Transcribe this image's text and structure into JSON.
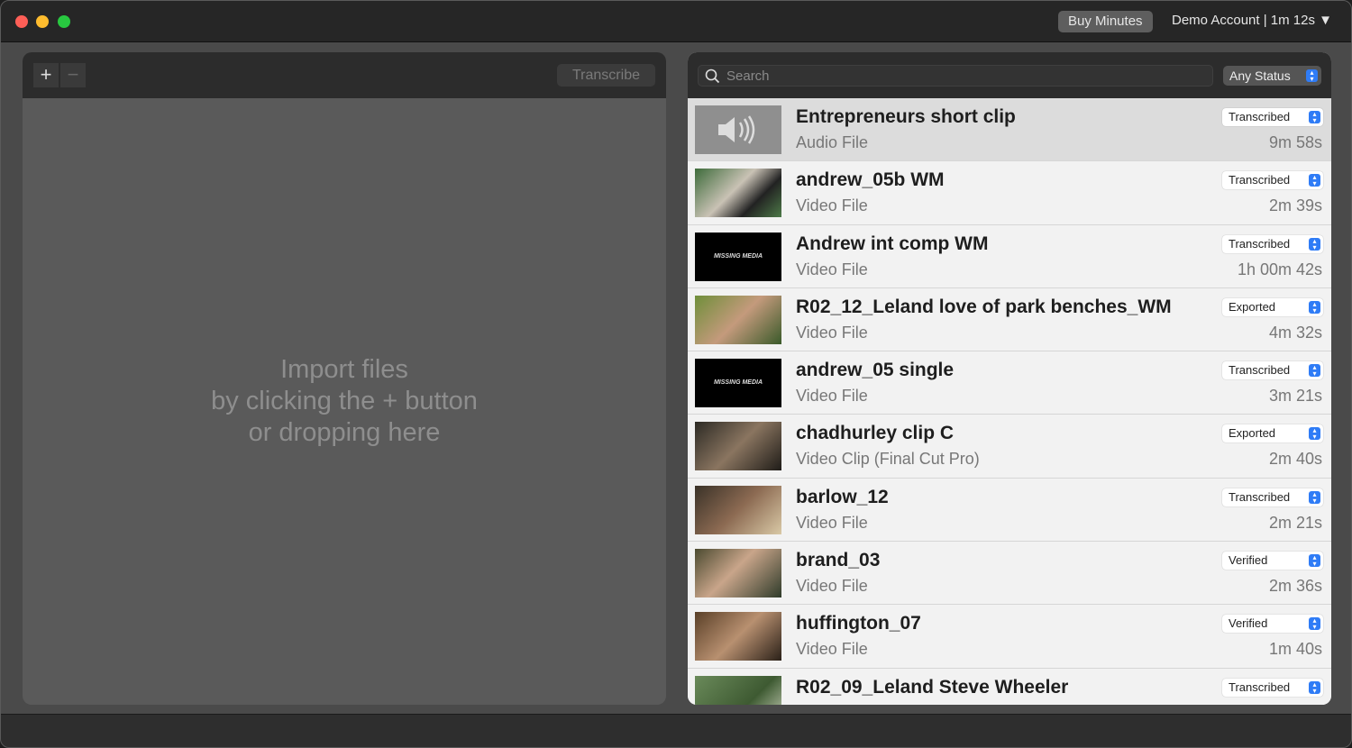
{
  "header": {
    "buy_minutes": "Buy Minutes",
    "account": "Demo Account | 1m 12s ▼"
  },
  "left": {
    "add": "+",
    "remove": "−",
    "transcribe": "Transcribe",
    "drop_lines": [
      "Import files",
      "by clicking the + button",
      "or dropping here"
    ]
  },
  "right": {
    "search_placeholder": "Search",
    "status_filter": "Any Status",
    "items": [
      {
        "name": "Entrepreneurs short clip",
        "type": "Audio File",
        "status": "Transcribed",
        "duration": "9m 58s",
        "thumb": "audio"
      },
      {
        "name": "andrew_05b WM",
        "type": "Video File",
        "status": "Transcribed",
        "duration": "2m 39s",
        "thumb": "video"
      },
      {
        "name": "Andrew int comp WM",
        "type": "Video File",
        "status": "Transcribed",
        "duration": "1h 00m 42s",
        "thumb": "missing"
      },
      {
        "name": "R02_12_Leland love of park benches_WM",
        "type": "Video File",
        "status": "Exported",
        "duration": "4m 32s",
        "thumb": "video"
      },
      {
        "name": "andrew_05 single",
        "type": "Video File",
        "status": "Transcribed",
        "duration": "3m 21s",
        "thumb": "missing"
      },
      {
        "name": "chadhurley clip C",
        "type": "Video Clip (Final Cut Pro)",
        "status": "Exported",
        "duration": "2m 40s",
        "thumb": "video"
      },
      {
        "name": "barlow_12",
        "type": "Video File",
        "status": "Transcribed",
        "duration": "2m 21s",
        "thumb": "video"
      },
      {
        "name": "brand_03",
        "type": "Video File",
        "status": "Verified",
        "duration": "2m 36s",
        "thumb": "video"
      },
      {
        "name": "huffington_07",
        "type": "Video File",
        "status": "Verified",
        "duration": "1m 40s",
        "thumb": "video"
      },
      {
        "name": "R02_09_Leland Steve Wheeler",
        "type": "",
        "status": "Transcribed",
        "duration": "",
        "thumb": "video"
      }
    ],
    "missing_media_label": "MISSING MEDIA"
  }
}
